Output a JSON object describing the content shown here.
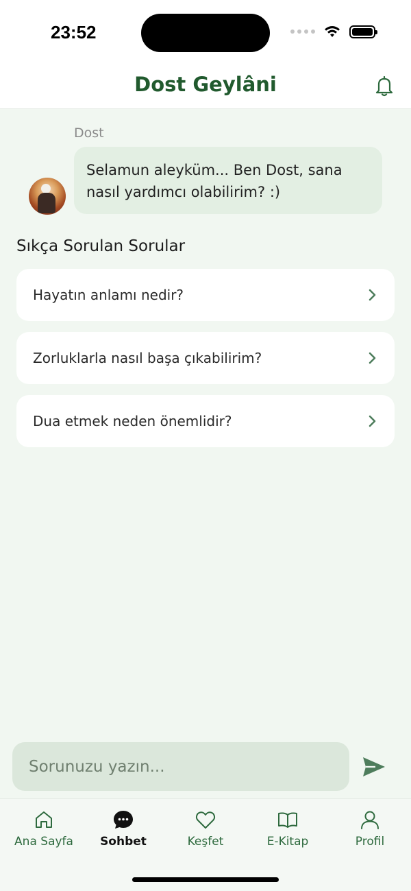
{
  "status_bar": {
    "time": "23:52"
  },
  "header": {
    "title": "Dost Geylâni"
  },
  "chat": {
    "sender": "Dost",
    "message": "Selamun aleyküm... Ben Dost, sana nasıl yardımcı olabilirim? :)"
  },
  "faq": {
    "title": "Sıkça Sorulan Sorular",
    "items": [
      {
        "label": "Hayatın anlamı nedir?"
      },
      {
        "label": "Zorluklarla nasıl başa çıkabilirim?"
      },
      {
        "label": "Dua etmek neden önemlidir?"
      }
    ]
  },
  "composer": {
    "placeholder": "Sorunuzu yazın..."
  },
  "nav": {
    "items": [
      {
        "label": "Ana Sayfa",
        "icon": "home-icon"
      },
      {
        "label": "Sohbet",
        "icon": "chat-bubble-icon",
        "active": true
      },
      {
        "label": "Keşfet",
        "icon": "heart-icon"
      },
      {
        "label": "E-Kitap",
        "icon": "book-icon"
      },
      {
        "label": "Profil",
        "icon": "user-icon"
      }
    ]
  },
  "colors": {
    "brand": "#215a2e",
    "background": "#f1f7f1",
    "bubble": "#e3efe3",
    "accent": "#4e7d5c"
  }
}
